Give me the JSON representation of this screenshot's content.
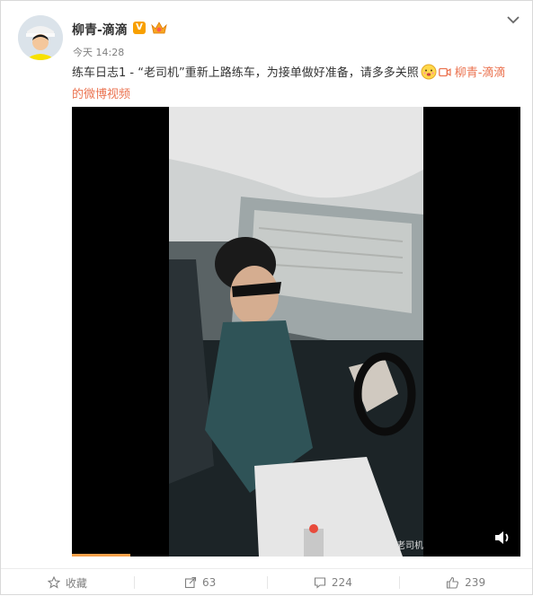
{
  "post": {
    "author_name": "柳青-滴滴",
    "verified_label": "V",
    "time": "今天 14:28",
    "text_main": "练车日志1 - “老司机”重新上路练车，为接单做好准备，请多多关照",
    "link_text": "柳青-滴滴的微博视频",
    "link_icon": "video-link-icon"
  },
  "video": {
    "watermark": "老司机",
    "progress": 0.13,
    "volume_icon": "volume-icon"
  },
  "actions": {
    "collect_label": "收藏",
    "repost_count": "63",
    "comment_count": "224",
    "like_count": "239"
  },
  "colors": {
    "link": "#eb7350",
    "badge": "#f8a000",
    "progress": "#f7a14a"
  }
}
